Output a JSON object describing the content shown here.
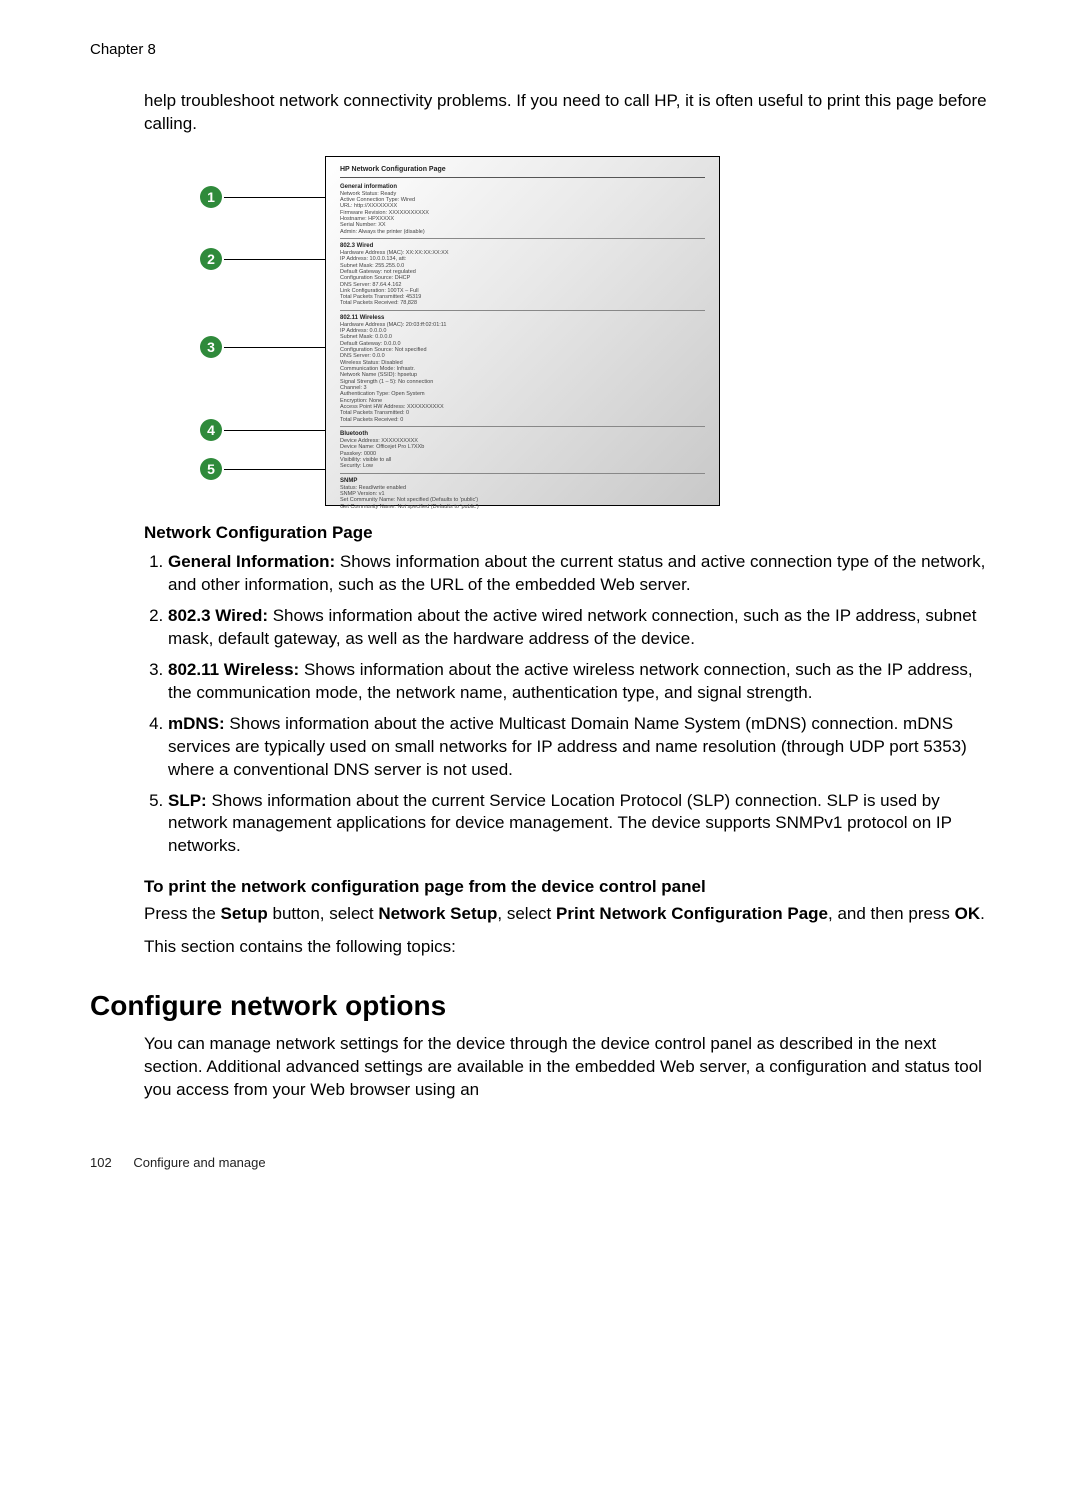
{
  "chapter": "Chapter 8",
  "intro": "help troubleshoot network connectivity problems. If you need to call HP, it is often useful to print this page before calling.",
  "diagram": {
    "page_title": "HP Network Configuration Page",
    "callouts": [
      "1",
      "2",
      "3",
      "4",
      "5"
    ],
    "sections": {
      "general": {
        "head": "General information",
        "lines": [
          "Network Status: Ready",
          "Active Connection Type: Wired",
          "URL: http://XXXXXXXX",
          "Firmware Revision: XXXXXXXXXXX",
          "Hostname: HPXXXXX",
          "Serial Number: XX",
          "Admin: Always the printer (disable)"
        ]
      },
      "wired": {
        "head": "802.3 Wired",
        "lines": [
          "Hardware Address (MAC): XX:XX:XX:XX:XX",
          "IP Address: 10.0.0.134, att:",
          "Subnet Mask: 255.255.0.0",
          "Default Gateway: not regulated",
          "Configuration Source: DHCP",
          "DNS Server: 87.64.4.162",
          "Link Configuration: 100TX – Full",
          "Total Packets Transmitted: 45319",
          "Total Packets Received: 78,828"
        ]
      },
      "wireless": {
        "head": "802.11 Wireless",
        "lines": [
          "Hardware Address (MAC): 20:03:ff:02:01:11",
          "IP Address: 0.0.0.0",
          "Subnet Mask: 0.0.0.0",
          "Default Gateway: 0.0.0.0",
          "Configuration Source: Not specified",
          "DNS Server: 0.0.0",
          "Wireless Status: Disabled",
          "Communication Mode: Infrastr.",
          "Network Name (SSID): hpsetup",
          "Signal Strength (1 – 5): No connection",
          "Channel: 3",
          "Authentication Type: Open System",
          "Encryption: None",
          "Access Point HW Address: XXXXXXXXXX",
          "Total Packets Transmitted: 0",
          "Total Packets Received: 0"
        ]
      },
      "mdns": {
        "head": "Bluetooth",
        "lines": [
          "Device Address: XXXXXXXXXX",
          "Device Name: Officejet Pro L7XXb",
          "Passkey: 0000",
          "Visibility: visible to all",
          "Security: Low"
        ]
      },
      "slp": {
        "head": "SNMP",
        "lines": [
          "Status: Read/write enabled",
          "SNMP Version: v1",
          "Set Community Name: Not specified (Defaults to 'public')",
          "Get Community Name: Not specified (Defaults to 'public')"
        ]
      }
    }
  },
  "config_heading": "Network Configuration Page",
  "config_items": [
    {
      "label": "General Information:",
      "text": " Shows information about the current status and active connection type of the network, and other information, such as the URL of the embedded Web server."
    },
    {
      "label": "802.3 Wired:",
      "text": " Shows information about the active wired network connection, such as the IP address, subnet mask, default gateway, as well as the hardware address of the device."
    },
    {
      "label": "802.11 Wireless:",
      "text": " Shows information about the active wireless network connection, such as the IP address, the communication mode, the network name, authentication type, and signal strength."
    },
    {
      "label": "mDNS:",
      "text": " Shows information about the active Multicast Domain Name System (mDNS) connection. mDNS services are typically used on small networks for IP address and name resolution (through UDP port 5353) where a conventional DNS server is not used."
    },
    {
      "label": "SLP:",
      "text": " Shows information about the current Service Location Protocol (SLP) connection. SLP is used by network management applications for device management. The device supports SNMPv1 protocol on IP networks."
    }
  ],
  "print_heading": "To print the network configuration page from the device control panel",
  "print_steps": {
    "pre": "Press the ",
    "b1": "Setup",
    "mid1": " button, select ",
    "b2": "Network Setup",
    "mid2": ", select ",
    "b3": "Print Network Configuration Page",
    "mid3": ", and then press ",
    "b4": "OK",
    "post": "."
  },
  "topics_line": "This section contains the following topics:",
  "configure_heading": "Configure network options",
  "configure_text": "You can manage network settings for the device through the device control panel as described in the next section. Additional advanced settings are available in the embedded Web server, a configuration and status tool you access from your Web browser using an",
  "footer": {
    "page": "102",
    "title": "Configure and manage"
  }
}
